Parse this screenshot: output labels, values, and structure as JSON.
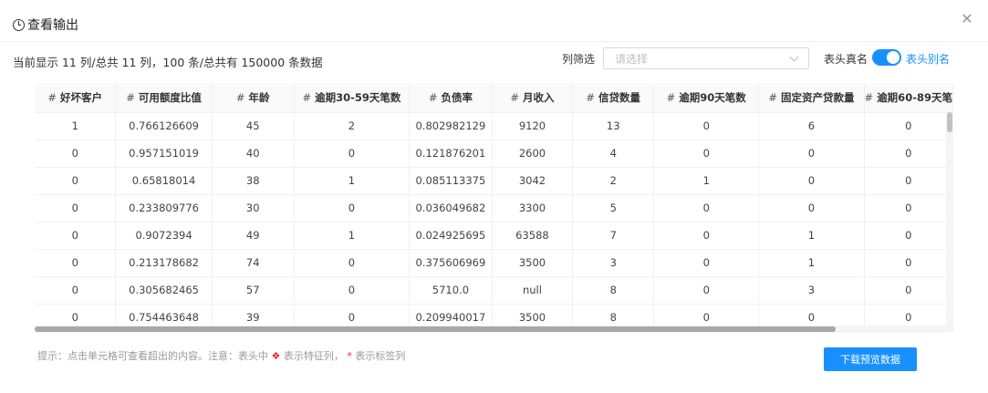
{
  "header": {
    "title": "查看输出"
  },
  "summary": "当前显示 11 列/总共 11 列，100 条/总共有 150000 条数据",
  "filter": {
    "label": "列筛选",
    "placeholder": "请选择"
  },
  "alias": {
    "left_label": "表头真名",
    "right_label": "表头别名",
    "enabled": true
  },
  "table": {
    "columns": [
      {
        "hash": "#",
        "label": "好坏客户"
      },
      {
        "hash": "#",
        "label": "可用额度比值"
      },
      {
        "hash": "#",
        "label": "年龄"
      },
      {
        "hash": "#",
        "label": "逾期30-59天笔数"
      },
      {
        "hash": "#",
        "label": "负债率"
      },
      {
        "hash": "#",
        "label": "月收入"
      },
      {
        "hash": "#",
        "label": "信贷数量"
      },
      {
        "hash": "#",
        "label": "逾期90天笔数"
      },
      {
        "hash": "#",
        "label": "固定资产贷款量"
      },
      {
        "hash": "#",
        "label": "逾期60-89天笔"
      }
    ],
    "rows": [
      [
        "1",
        "0.766126609",
        "45",
        "2",
        "0.802982129",
        "9120",
        "13",
        "0",
        "6",
        "0"
      ],
      [
        "0",
        "0.957151019",
        "40",
        "0",
        "0.121876201",
        "2600",
        "4",
        "0",
        "0",
        "0"
      ],
      [
        "0",
        "0.65818014",
        "38",
        "1",
        "0.085113375",
        "3042",
        "2",
        "1",
        "0",
        "0"
      ],
      [
        "0",
        "0.233809776",
        "30",
        "0",
        "0.036049682",
        "3300",
        "5",
        "0",
        "0",
        "0"
      ],
      [
        "0",
        "0.9072394",
        "49",
        "1",
        "0.024925695",
        "63588",
        "7",
        "0",
        "1",
        "0"
      ],
      [
        "0",
        "0.213178682",
        "74",
        "0",
        "0.375606969",
        "3500",
        "3",
        "0",
        "1",
        "0"
      ],
      [
        "0",
        "0.305682465",
        "57",
        "0",
        "5710.0",
        "null",
        "8",
        "0",
        "3",
        "0"
      ],
      [
        "0",
        "0.754463648",
        "39",
        "0",
        "0.209940017",
        "3500",
        "8",
        "0",
        "0",
        "0"
      ]
    ]
  },
  "footer": {
    "tip_prefix": "提示：点击单元格可查看超出的内容。注意：表头中",
    "tip_feature": "表示特征列，",
    "tip_star": "*",
    "tip_label": "表示标签列",
    "download_label": "下载预览数据"
  },
  "colors": {
    "accent": "#1890ff",
    "label_marker": "#f5222d"
  },
  "icons": {
    "header": "clock-icon",
    "close": "close-icon",
    "select": "chevron-down-icon",
    "feature": "feature-column-icon"
  }
}
